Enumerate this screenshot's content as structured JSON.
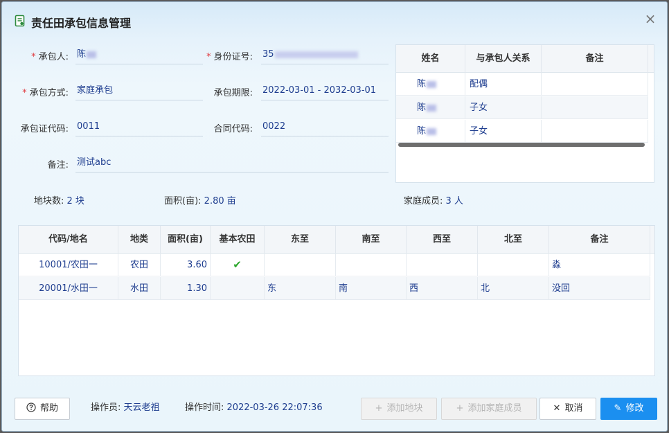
{
  "dialog": {
    "title": "责任田承包信息管理",
    "title_icon": "document-icon",
    "close_glyph": "×"
  },
  "form": {
    "contractor_label": "承包人:",
    "contractor_value": "陈",
    "id_label": "身份证号:",
    "id_value": "35",
    "method_label": "承包方式:",
    "method_value": "家庭承包",
    "period_label": "承包期限:",
    "period_value": "2022-03-01 - 2032-03-01",
    "cert_label": "承包证代码:",
    "cert_value": "0011",
    "contract_label": "合同代码:",
    "contract_value": "0022",
    "remark_label": "备注:",
    "remark_value": "测试abc",
    "required_mark": "*"
  },
  "members": {
    "columns": [
      "姓名",
      "与承包人关系",
      "备注"
    ],
    "rows": [
      {
        "name": "陈",
        "relation": "配偶",
        "remark": ""
      },
      {
        "name": "陈",
        "relation": "子女",
        "remark": ""
      },
      {
        "name": "陈",
        "relation": "子女",
        "remark": ""
      }
    ]
  },
  "summary": {
    "plots_label": "地块数:",
    "plots_value": "2 块",
    "area_label": "面积(亩):",
    "area_value": "2.80 亩",
    "family_label": "家庭成员:",
    "family_value": "3 人"
  },
  "lands": {
    "columns": [
      "代码/地名",
      "地类",
      "面积(亩)",
      "基本农田",
      "东至",
      "南至",
      "西至",
      "北至",
      "备注"
    ],
    "rows": [
      {
        "code": "10001/农田一",
        "type": "农田",
        "area": "3.60",
        "basic": "✔",
        "east": "",
        "south": "",
        "west": "",
        "north": "",
        "remark": "淼"
      },
      {
        "code": "20001/水田一",
        "type": "水田",
        "area": "1.30",
        "basic": "",
        "east": "东",
        "south": "南",
        "west": "西",
        "north": "北",
        "remark": "没回"
      }
    ]
  },
  "footer": {
    "help": "帮助",
    "operator_label": "操作员:",
    "operator_value": "天云老祖",
    "time_label": "操作时间:",
    "time_value": "2022-03-26 22:07:36",
    "add_plot": "添加地块",
    "add_member": "添加家庭成员",
    "cancel": "取消",
    "edit": "修改"
  },
  "colors": {
    "accent": "#1b8ff0",
    "value_text": "#1e3d8f",
    "required": "#e0393e",
    "check": "#2fa82f"
  }
}
